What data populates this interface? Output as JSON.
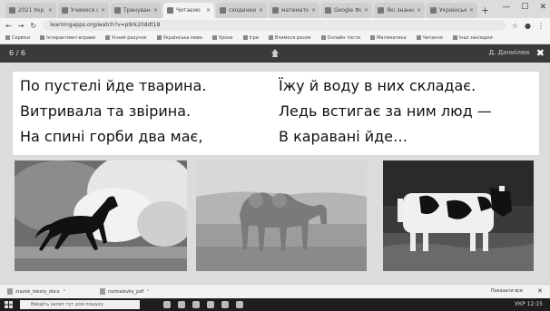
{
  "browser": {
    "tabs": [
      {
        "label": "2021 Укр",
        "active": false
      },
      {
        "label": "Учимося о",
        "active": false
      },
      {
        "label": "Тренування",
        "active": false
      },
      {
        "label": "Читаємо",
        "active": true
      },
      {
        "label": "сходинки",
        "active": false
      },
      {
        "label": "математика",
        "active": false
      },
      {
        "label": "Google Форми",
        "active": false
      },
      {
        "label": "Які знання",
        "active": false
      },
      {
        "label": "Українська",
        "active": false
      }
    ],
    "new_tab": "+",
    "url": "learningapps.org/watch?v=p9rk20ddt18",
    "bookmarks": [
      "Сервіси",
      "Інтерактивні вправи",
      "Усний рахунок",
      "Українська мова",
      "Уроки",
      "Ігри",
      "Вчимося разом",
      "Онлайн тести",
      "Математика",
      "Читання",
      "Інші закладки"
    ]
  },
  "app": {
    "counter": "6 / 6",
    "user": "Д. Даниїлюк",
    "close": "✖"
  },
  "poem": {
    "left": [
      "По пустелі йде тварина.",
      "Витривала та звірина.",
      "На спині горби два має,"
    ],
    "right": [
      "Їжу й воду в них складає.",
      "Ледь встигає за ним люд —",
      "В каравані йде…"
    ]
  },
  "downloads": {
    "items": [
      "zrazok_teksty_docx",
      "rozmalovky_pdf"
    ],
    "show_all": "Показати все",
    "close": "✕"
  },
  "taskbar": {
    "search_placeholder": "Введіть запит тут для пошуку",
    "time": "12:15",
    "lang": "УКР"
  }
}
